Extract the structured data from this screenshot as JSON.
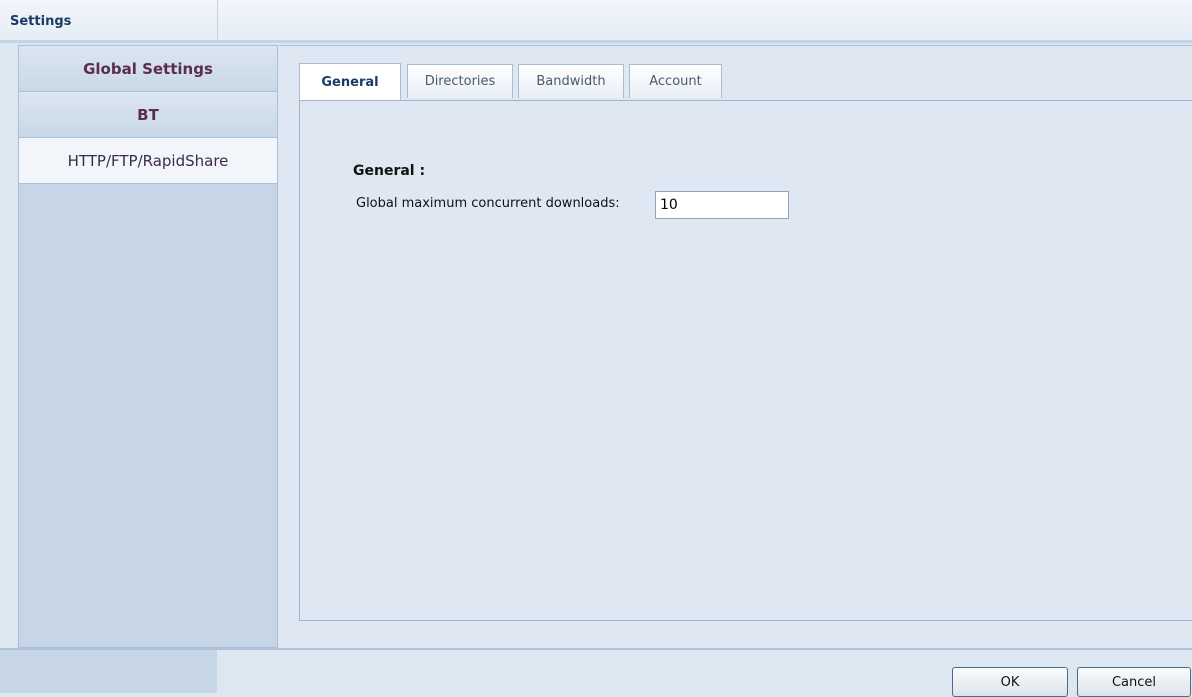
{
  "window": {
    "title": "Settings"
  },
  "sidebar": {
    "items": [
      {
        "label": "Global Settings"
      },
      {
        "label": "BT"
      },
      {
        "label": "HTTP/FTP/RapidShare"
      }
    ]
  },
  "tabs": [
    {
      "label": "General"
    },
    {
      "label": "Directories"
    },
    {
      "label": "Bandwidth"
    },
    {
      "label": "Account"
    }
  ],
  "general": {
    "section_title": "General :",
    "max_downloads_label": "Global maximum concurrent downloads:",
    "max_downloads_value": "10"
  },
  "buttons": {
    "ok": "OK",
    "cancel": "Cancel"
  }
}
